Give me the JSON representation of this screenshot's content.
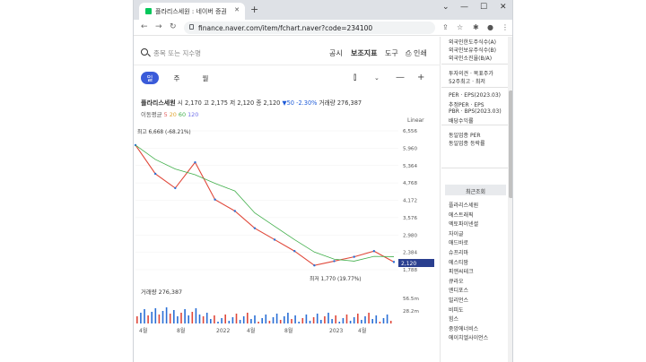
{
  "browser": {
    "tab_title": "플라리스세원 : 네이버 증권",
    "new_tab": "+",
    "url": "finance.naver.com/item/fchart.naver?code=234100"
  },
  "header": {
    "search_placeholder": "종목 또는 지수명",
    "tabs": [
      {
        "label": "공시"
      },
      {
        "label": "보조지표"
      },
      {
        "label": "도구"
      },
      {
        "label": "인쇄"
      }
    ]
  },
  "period_tabs": [
    {
      "label": "일"
    },
    {
      "label": "주"
    },
    {
      "label": "월"
    }
  ],
  "stock": {
    "name": "플라리스세원",
    "open_label": "시",
    "open": "2,170",
    "high_label": "고",
    "high": "2,175",
    "low_label": "저",
    "low": "2,120",
    "close_label": "종",
    "close": "2,120",
    "change": "▼50",
    "change_pct": "-2.30%",
    "volume_label": "거래량",
    "volume": "276,387"
  },
  "ma": {
    "label": "이동평균",
    "periods": [
      "5",
      "20",
      "60",
      "120"
    ],
    "colors": [
      "#e25a5a",
      "#e0a32e",
      "#3fae49",
      "#6e6eea"
    ]
  },
  "chart_data": {
    "type": "line",
    "scale": "Linear",
    "y_ticks": [
      "6,556",
      "5,960",
      "5,364",
      "4,768",
      "4,172",
      "3,576",
      "2,980",
      "2,384",
      "1,788"
    ],
    "x_ticks": [
      "4월",
      "8월",
      "2022",
      "4월",
      "8월",
      "2023",
      "4월"
    ],
    "current_price": "2,120",
    "high_annotation": "최고 6,668 (-68.21%)",
    "low_annotation": "최저 1,770 (19.77%)",
    "volume_title": "거래량 276,387",
    "volume_ticks": [
      "56.5m",
      "28.2m"
    ],
    "colors": {
      "up": "#e0483a",
      "down": "#2a6fd6",
      "price_tag": "#2a3f8f"
    },
    "x": [
      "2021-04",
      "2021-06",
      "2021-08",
      "2021-10",
      "2021-12",
      "2022-02",
      "2022-04",
      "2022-06",
      "2022-08",
      "2022-10",
      "2022-12",
      "2023-02",
      "2023-04",
      "2023-06"
    ],
    "values": [
      6200,
      5200,
      4700,
      5600,
      4300,
      3900,
      3300,
      2900,
      2500,
      2000,
      2150,
      2300,
      2500,
      2120
    ]
  },
  "sidebar": {
    "top_items": [
      "외국인한도주식수(A)",
      "외국인보유주식수(B)",
      "외국인소진율(B/A)"
    ],
    "opinion_items": [
      "투자의견 · 목표주가",
      "52주최고 · 최저"
    ],
    "per_items": [
      "PER · EPS(2023.03)",
      "추정PER · EPS",
      "PBR · BPS(2023.03)",
      "배당수익률"
    ],
    "industry_items": [
      "동일업종 PER",
      "동일업종 등락률"
    ],
    "recent_title": "최근조회",
    "recent": [
      "플라리스세원",
      "에스트래픽",
      "엑토파이넨셜",
      "자이글",
      "애드바로",
      "슈프리마",
      "에스티팜",
      "피앤씨테크",
      "큐라오",
      "엔디포스",
      "빌리언스",
      "비피도",
      "힘스",
      "중앙에너비스",
      "에이치엘사이언스"
    ]
  }
}
